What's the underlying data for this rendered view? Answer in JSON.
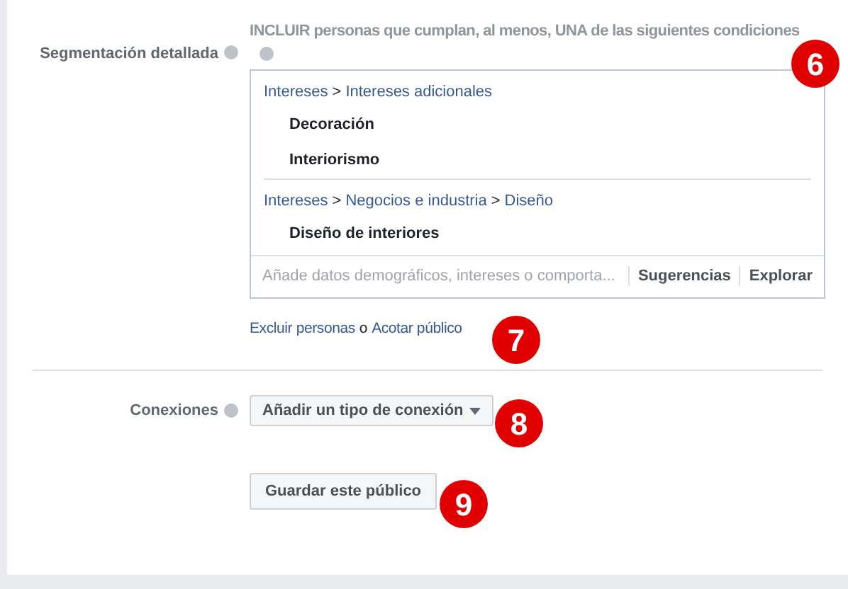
{
  "detailed_targeting": {
    "label": "Segmentación detallada",
    "include_text": "INCLUIR personas que cumplan, al menos, UNA de las siguientes condiciones",
    "badge": "6",
    "groups": [
      {
        "path": [
          {
            "kind": "link",
            "text": "Intereses"
          },
          {
            "kind": "separator",
            "text": ">"
          },
          {
            "kind": "link",
            "text": "Intereses adicionales"
          }
        ],
        "items": [
          "Decoración",
          "Interiorismo"
        ]
      },
      {
        "path": [
          {
            "kind": "link",
            "text": "Intereses"
          },
          {
            "kind": "separator",
            "text": ">"
          },
          {
            "kind": "link",
            "text": "Negocios e industria"
          },
          {
            "kind": "separator",
            "text": ">"
          },
          {
            "kind": "link",
            "text": "Diseño"
          }
        ],
        "items": [
          "Diseño de interiores"
        ]
      }
    ],
    "search": {
      "placeholder": "Añade datos demográficos, intereses o comporta..."
    },
    "actions": [
      "Sugerencias",
      "Explorar"
    ]
  },
  "links": {
    "exclude": "Excluir personas",
    "joiner": "o",
    "narrow": "Acotar público",
    "badge": "7"
  },
  "connections": {
    "label": "Conexiones",
    "dropdown": "Añadir un tipo de conexión",
    "badge": "8"
  },
  "save": {
    "button": "Guardar este público",
    "badge": "9"
  }
}
